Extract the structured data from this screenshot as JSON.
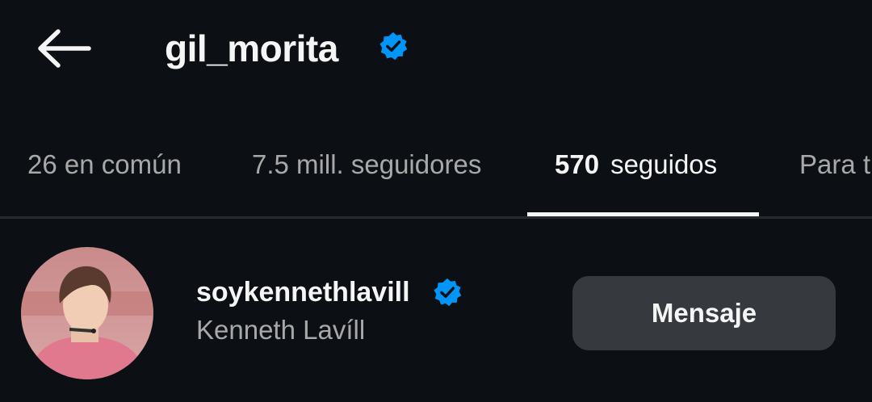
{
  "header": {
    "back_icon": "arrow-left-icon",
    "username": "gil_morita",
    "verified_icon": "verified-badge-icon",
    "verified_color": "#0095f6"
  },
  "tabs": [
    {
      "count": "26",
      "label": "en común",
      "active": false
    },
    {
      "count": "7.5 mill.",
      "label": "seguidores",
      "active": false
    },
    {
      "count": "570",
      "label": "seguidos",
      "active": true
    },
    {
      "count": "",
      "label": "Para t",
      "active": false
    }
  ],
  "list": [
    {
      "username": "soykennethlavill",
      "full_name": "Kenneth Lavíll",
      "verified": true,
      "avatar": "profile-photo",
      "action_label": "Mensaje"
    }
  ],
  "colors": {
    "background": "#0c1014",
    "text_primary": "#f5f5f5",
    "text_secondary": "#a8a8a8",
    "button_bg": "#363a3f",
    "accent": "#0095f6"
  }
}
